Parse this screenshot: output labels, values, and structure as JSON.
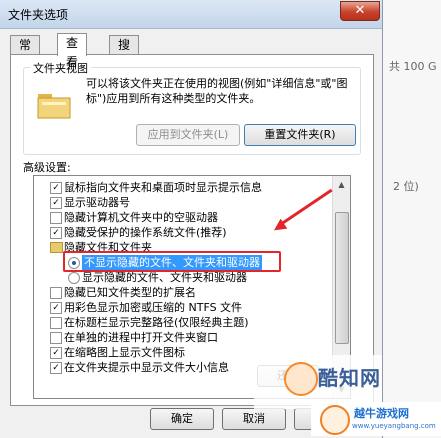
{
  "window": {
    "title": "文件夹选项",
    "close_glyph": "✕"
  },
  "tabs": [
    {
      "label": "常规",
      "active": false
    },
    {
      "label": "查看",
      "active": true
    },
    {
      "label": "搜索",
      "active": false
    }
  ],
  "folder_views": {
    "title": "文件夹视图",
    "description": "可以将该文件夹正在使用的视图(例如\"详细信息\"或\"图标\")应用到所有这种类型的文件夹。",
    "apply_button": "应用到文件夹(L)",
    "reset_button": "重置文件夹(R)"
  },
  "advanced": {
    "label": "高级设置:",
    "items": [
      {
        "type": "checkbox",
        "checked": true,
        "label": "鼠标指向文件夹和桌面项时显示提示信息"
      },
      {
        "type": "checkbox",
        "checked": true,
        "label": "显示驱动器号"
      },
      {
        "type": "checkbox",
        "checked": false,
        "label": "隐藏计算机文件夹中的空驱动器"
      },
      {
        "type": "checkbox",
        "checked": true,
        "label": "隐藏受保护的操作系统文件(推荐)"
      },
      {
        "type": "folder",
        "label": "隐藏文件和文件夹"
      },
      {
        "type": "radio",
        "checked": true,
        "label": "不显示隐藏的文件、文件夹和驱动器"
      },
      {
        "type": "radio",
        "checked": false,
        "label": "显示隐藏的文件、文件夹和驱动器"
      },
      {
        "type": "checkbox",
        "checked": false,
        "label": "隐藏已知文件类型的扩展名"
      },
      {
        "type": "checkbox",
        "checked": true,
        "label": "用彩色显示加密或压缩的 NTFS 文件"
      },
      {
        "type": "checkbox",
        "checked": false,
        "label": "在标题栏显示完整路径(仅限经典主题)"
      },
      {
        "type": "checkbox",
        "checked": false,
        "label": "在单独的进程中打开文件夹窗口"
      },
      {
        "type": "checkbox",
        "checked": true,
        "label": "在缩略图上显示文件图标"
      },
      {
        "type": "checkbox",
        "checked": true,
        "label": "在文件夹提示中显示文件大小信息"
      }
    ],
    "restore_button": "还原"
  },
  "footer": {
    "ok": "确定",
    "cancel": "取消",
    "apply": "应用"
  },
  "background": {
    "snippet1": "共 100 G",
    "snippet2": "2 位)"
  },
  "watermark": {
    "brand": "酷知网",
    "site_title": "越牛游戏网",
    "site_url": "www.yueyangbang.com"
  },
  "colors": {
    "annotation_red": "#e3262b",
    "selection_blue": "#3399ff"
  }
}
